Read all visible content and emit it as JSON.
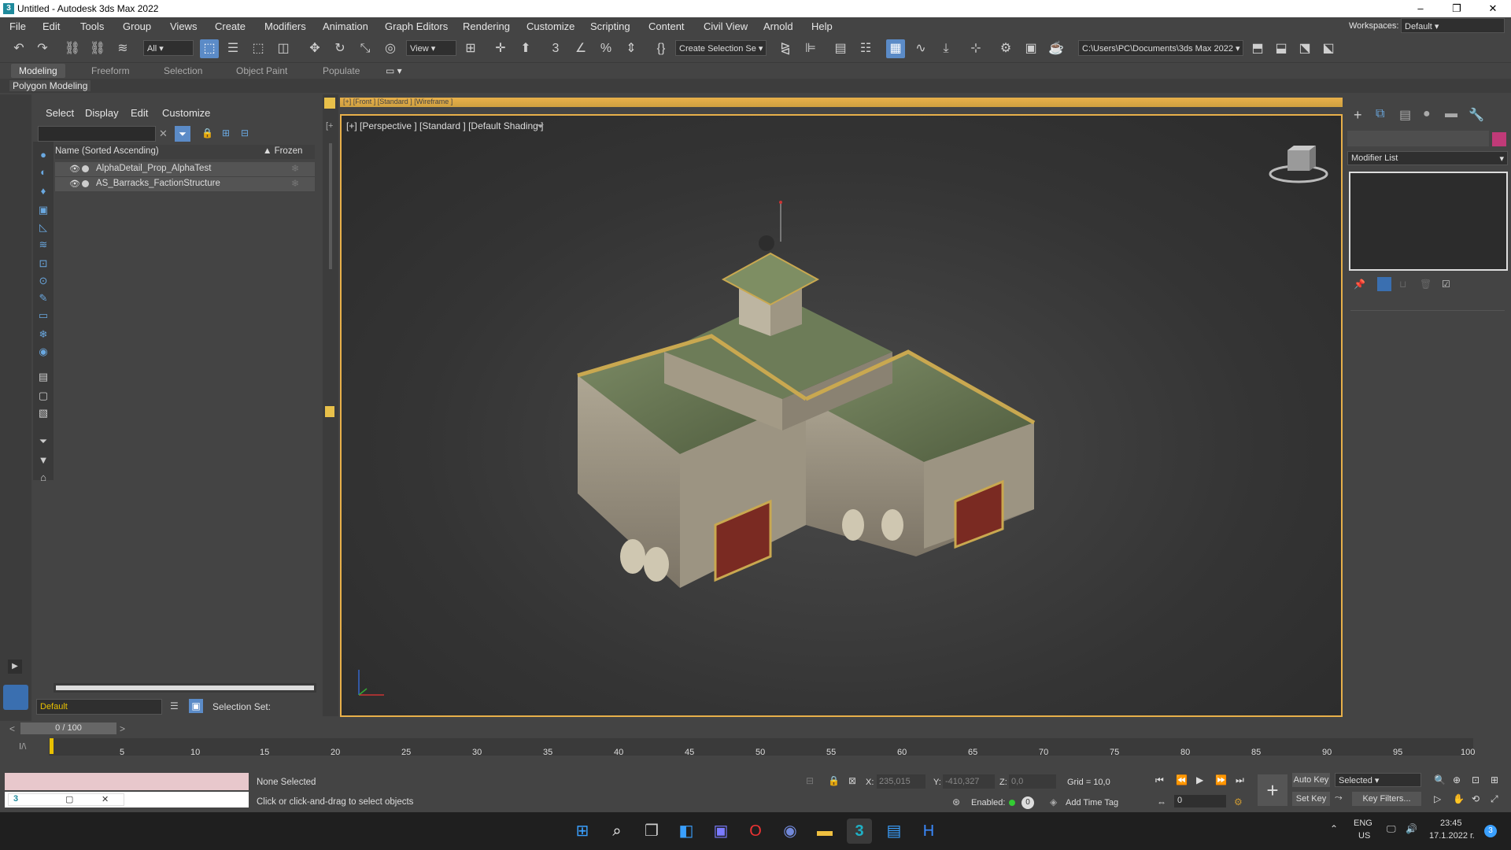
{
  "window": {
    "title": "Untitled - Autodesk 3ds Max 2022",
    "minimize": "–",
    "maximize": "❐",
    "close": "✕"
  },
  "menu": [
    "File",
    "Edit",
    "Tools",
    "Group",
    "Views",
    "Create",
    "Modifiers",
    "Animation",
    "Graph Editors",
    "Rendering",
    "Customize",
    "Scripting",
    "Content",
    "Civil View",
    "Arnold",
    "Help"
  ],
  "workspaces": {
    "label": "Workspaces:",
    "value": "Default"
  },
  "toolbar": {
    "filter": "All",
    "refcoord": "View",
    "selection_set": "Create Selection Se",
    "project_path": "C:\\Users\\PC\\Documents\\3ds Max 2022"
  },
  "ribbon": {
    "tabs": [
      "Modeling",
      "Freeform",
      "Selection",
      "Object Paint",
      "Populate"
    ],
    "sub": "Polygon Modeling"
  },
  "scene_explorer": {
    "tabs": [
      "Select",
      "Display",
      "Edit",
      "Customize"
    ],
    "column_name": "Name (Sorted Ascending)",
    "column_frozen": "▲ Frozen",
    "items": [
      "AlphaDetail_Prop_AlphaTest",
      "AS_Barracks_FactionStructure"
    ],
    "layer": "Default",
    "selection_set": "Selection Set:"
  },
  "viewport": {
    "label": "[+] [Perspective ] [Standard ] [Default Shading ]",
    "top_label": "[+] [Front ] [Standard ] [Wireframe ]"
  },
  "command_panel": {
    "modifier_list": "Modifier List"
  },
  "timeline": {
    "frame": "0 / 100",
    "ticks": [
      "5",
      "10",
      "15",
      "20",
      "25",
      "30",
      "35",
      "40",
      "45",
      "50",
      "55",
      "60",
      "65",
      "70",
      "75",
      "80",
      "85",
      "90",
      "95",
      "100"
    ]
  },
  "status": {
    "selection": "None Selected",
    "prompt": "Click or click-and-drag to select objects",
    "x_label": "X:",
    "x": "235,015",
    "y_label": "Y:",
    "y": "-410,327",
    "z_label": "Z:",
    "z": "0,0",
    "grid": "Grid = 10,0",
    "enabled": "Enabled:",
    "add_time_tag": "Add Time Tag",
    "auto_key": "Auto Key",
    "set_key": "Set Key",
    "key_mode": "Selected",
    "key_filters": "Key Filters...",
    "frame_field": "0"
  },
  "taskbar": {
    "lang": "ENG",
    "region": "US",
    "time": "23:45",
    "date": "17.1.2022 г.",
    "badge": "3"
  }
}
